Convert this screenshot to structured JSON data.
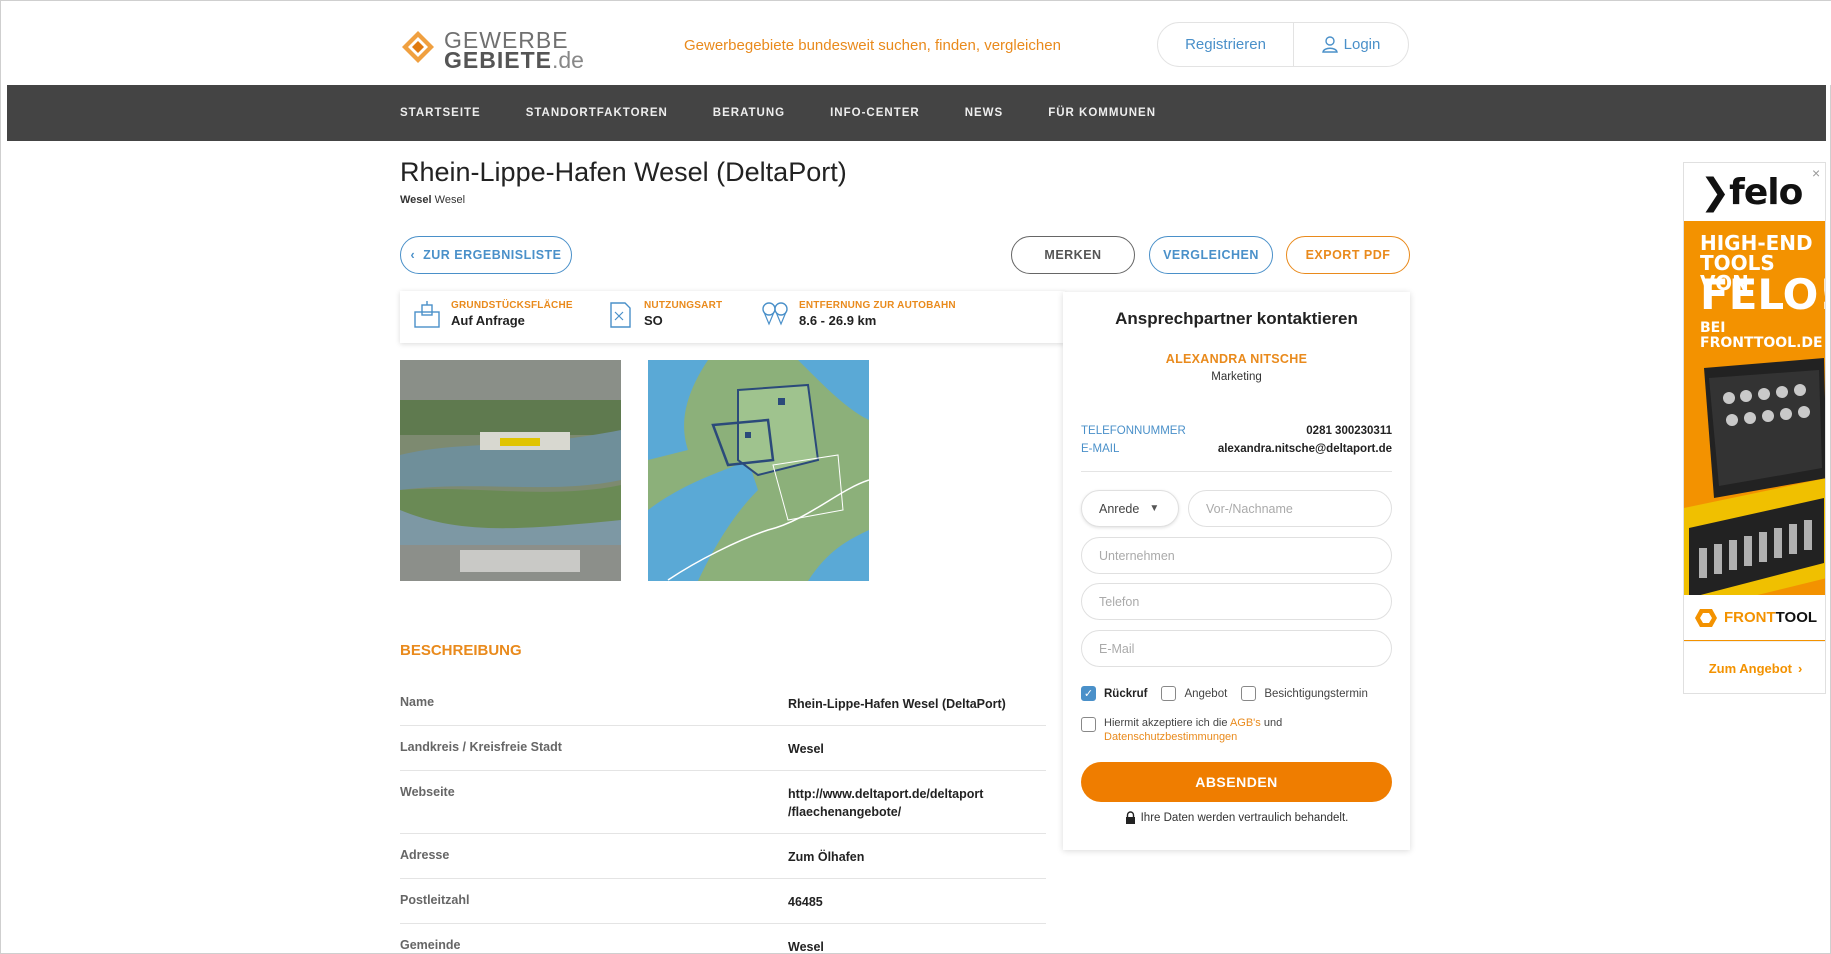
{
  "header": {
    "logo_line1": "GEWERBE",
    "logo_line2": "GEBIETE",
    "logo_suffix": ".de",
    "tagline": "Gewerbegebiete bundesweit suchen, finden, vergleichen",
    "register_label": "Registrieren",
    "login_label": "Login",
    "login_icon": "user-icon"
  },
  "nav": {
    "items": [
      "STARTSEITE",
      "STANDORTFAKTOREN",
      "BERATUNG",
      "INFO-CENTER",
      "NEWS",
      "FÜR KOMMUNEN"
    ]
  },
  "page": {
    "title": "Rhein-Lippe-Hafen Wesel (DeltaPort)",
    "subtitle_bold": "Wesel",
    "subtitle_rest": "Wesel"
  },
  "actions": {
    "back_label": "ZUR ERGEBNISLISTE",
    "merken_label": "MERKEN",
    "vergleichen_label": "VERGLEICHEN",
    "export_label": "EXPORT PDF"
  },
  "infobar": [
    {
      "label": "GRUNDSTÜCKSFLÄCHE",
      "value": "Auf Anfrage",
      "icon": "plot-area-icon"
    },
    {
      "label": "NUTZUNGSART",
      "value": "SO",
      "icon": "usage-type-icon"
    },
    {
      "label": "ENTFERNUNG ZUR AUTOBAHN",
      "value": "8.6 - 26.9 km",
      "icon": "distance-icon"
    }
  ],
  "description": {
    "title": "BESCHREIBUNG",
    "rows": [
      {
        "key": "Name",
        "value": "Rhein-Lippe-Hafen Wesel (DeltaPort)"
      },
      {
        "key": "Landkreis / Kreisfreie Stadt",
        "value": "Wesel"
      },
      {
        "key": "Webseite",
        "value": "http://www.deltaport.de/deltaport\n/flaechenangebote/"
      },
      {
        "key": "Adresse",
        "value": "Zum Ölhafen"
      },
      {
        "key": "Postleitzahl",
        "value": "46485"
      },
      {
        "key": "Gemeinde",
        "value": "Wesel"
      }
    ]
  },
  "contact": {
    "heading": "Ansprechpartner kontaktieren",
    "name": "ALEXANDRA NITSCHE",
    "role": "Marketing",
    "phone_label": "TELEFONNUMMER",
    "phone_value": "0281 300230311",
    "email_label": "E-MAIL",
    "email_value": "alexandra.nitsche@deltaport.de",
    "anrede_value": "Anrede",
    "name_placeholder": "Vor-/Nachname",
    "company_placeholder": "Unternehmen",
    "phone_placeholder": "Telefon",
    "email_placeholder": "E-Mail",
    "checks": [
      {
        "label": "Rückruf",
        "checked": true
      },
      {
        "label": "Angebot",
        "checked": false
      },
      {
        "label": "Besichtigungstermin",
        "checked": false
      }
    ],
    "agb_text_1": "Hiermit akzeptiere ich die ",
    "agb_link": "AGB's",
    "agb_text_2": " und",
    "datenschutz_link": "Datenschutzbestimmungen",
    "submit_label": "ABSENDEN",
    "privacy_text": "Ihre Daten werden vertraulich behandelt."
  },
  "ad": {
    "brand_logo": "felo",
    "line1": "HIGH-END",
    "line2": "TOOLS VON",
    "line3": "FELO!",
    "line4": "BEI",
    "line5": "FRONTTOOL.DE",
    "brand_front": "FRONT",
    "brand_tool": "TOOL",
    "cta": "Zum Angebot",
    "close": "×"
  },
  "colors": {
    "accent_orange": "#e98a1c",
    "accent_blue": "#4a90c9",
    "nav_bg": "#444444",
    "submit_bg": "#ef7d00"
  }
}
